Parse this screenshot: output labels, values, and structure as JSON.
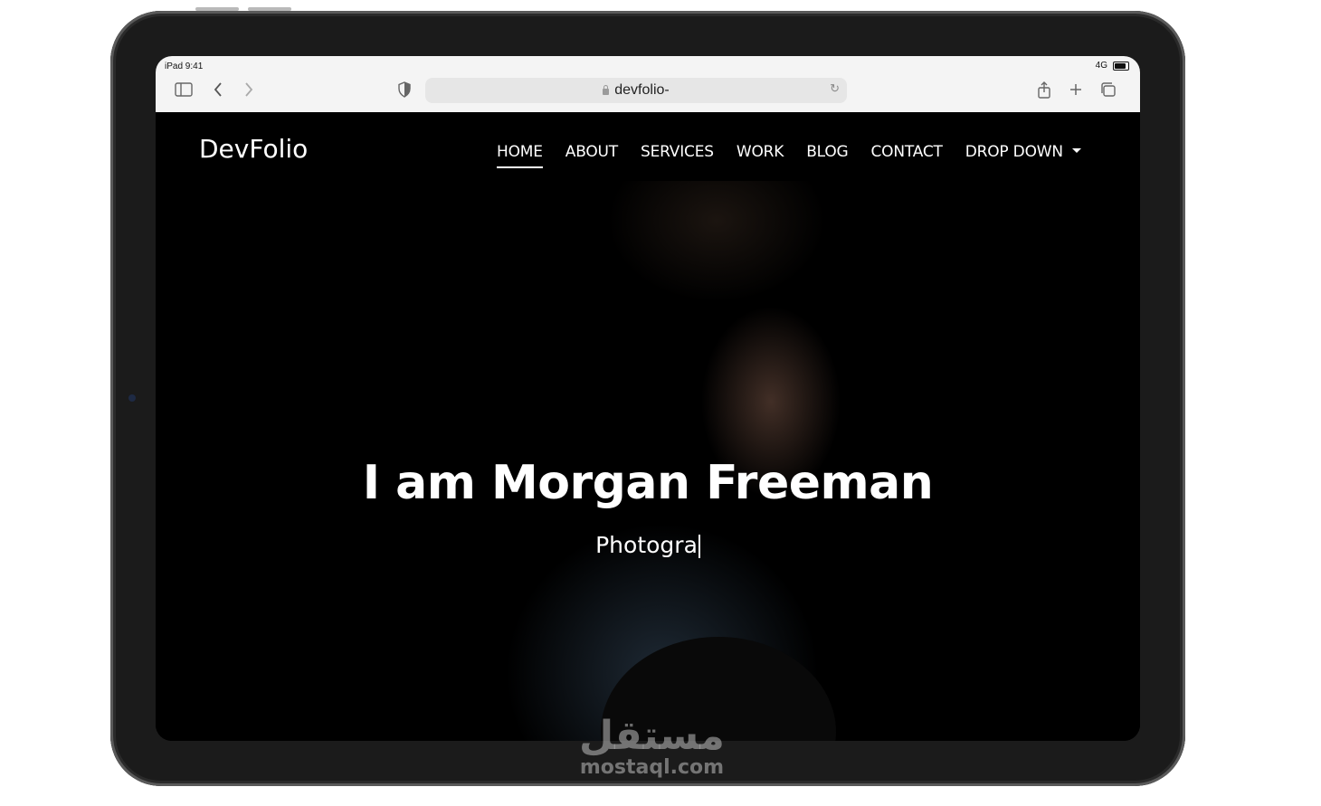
{
  "device": {
    "time": "iPad 9:41",
    "network": "4G"
  },
  "browser": {
    "url": "devfolio-"
  },
  "site": {
    "brand": "DevFolio",
    "nav": [
      "HOME",
      "ABOUT",
      "SERVICES",
      "WORK",
      "BLOG",
      "CONTACT",
      "DROP DOWN"
    ],
    "active_nav": "HOME",
    "hero_title": "I am Morgan Freeman",
    "hero_subtitle": "Photogra"
  },
  "watermark": {
    "arabic": "مستقل",
    "latin": "mostaql.com"
  }
}
